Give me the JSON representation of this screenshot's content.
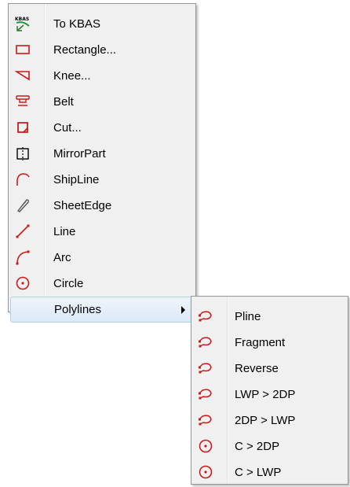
{
  "main_menu": {
    "items": [
      {
        "label": "To KBAS",
        "icon": "kbas-arrow-icon",
        "icon_text": "KBAS"
      },
      {
        "label": "Rectangle...",
        "icon": "rectangle-icon"
      },
      {
        "label": "Knee...",
        "icon": "knee-icon"
      },
      {
        "label": "Belt",
        "icon": "belt-icon"
      },
      {
        "label": "Cut...",
        "icon": "cut-icon"
      },
      {
        "label": "MirrorPart",
        "icon": "mirror-part-icon"
      },
      {
        "label": "ShipLine",
        "icon": "ship-line-icon"
      },
      {
        "label": "SheetEdge",
        "icon": "sheet-edge-icon"
      },
      {
        "label": "Line",
        "icon": "line-icon"
      },
      {
        "label": "Arc",
        "icon": "arc-icon"
      },
      {
        "label": "Circle",
        "icon": "circle-icon"
      },
      {
        "label": "Polylines",
        "icon": "none",
        "has_submenu": true,
        "highlighted": true
      }
    ]
  },
  "submenu": {
    "items": [
      {
        "label": "Pline",
        "icon": "polyline-icon"
      },
      {
        "label": "Fragment",
        "icon": "polyline-icon"
      },
      {
        "label": "Reverse",
        "icon": "polyline-icon"
      },
      {
        "label": "LWP > 2DP",
        "icon": "polyline-icon"
      },
      {
        "label": "2DP > LWP",
        "icon": "polyline-icon"
      },
      {
        "label": "C > 2DP",
        "icon": "circle-icon"
      },
      {
        "label": "C > LWP",
        "icon": "circle-icon"
      }
    ]
  },
  "colors": {
    "icon_red": "#d01818",
    "kbas_green": "#1a9a3a",
    "menu_bg": "#f0f0f0",
    "highlight_border": "#aecff7"
  }
}
